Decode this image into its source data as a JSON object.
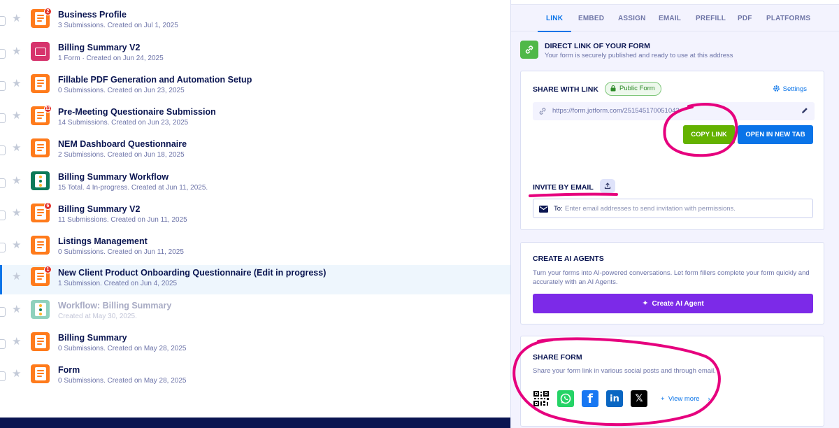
{
  "forms": [
    {
      "title": "Business Profile",
      "meta": "3 Submissions. Created on Jul 1, 2025",
      "badge": "2",
      "icon": "form-icon",
      "color": "#ff7b1c"
    },
    {
      "title": "Billing Summary V2",
      "meta": "1 Form · Created on Jun 24, 2025",
      "badge": "",
      "icon": "sign-document-icon",
      "color": "#d6336c"
    },
    {
      "title": "Fillable PDF Generation and Automation Setup",
      "meta": "0 Submissions. Created on Jun 23, 2025",
      "badge": "",
      "icon": "form-icon",
      "color": "#ff7b1c"
    },
    {
      "title": "Pre-Meeting Questionaire Submission",
      "meta": "14 Submissions. Created on Jun 23, 2025",
      "badge": "11",
      "icon": "form-icon",
      "color": "#ff7b1c"
    },
    {
      "title": "NEM Dashboard Questionnaire",
      "meta": "2 Submissions. Created on Jun 18, 2025",
      "badge": "",
      "icon": "form-icon",
      "color": "#ff7b1c"
    },
    {
      "title": "Billing Summary Workflow",
      "meta": "15 Total. 4 In-progress. Created at Jun 11, 2025.",
      "badge": "",
      "icon": "workflow-icon",
      "color": "#0b7a58"
    },
    {
      "title": "Billing Summary V2",
      "meta": "11 Submissions. Created on Jun 11, 2025",
      "badge": "6",
      "icon": "form-icon",
      "color": "#ff7b1c"
    },
    {
      "title": "Listings Management",
      "meta": "0 Submissions. Created on Jun 11, 2025",
      "badge": "",
      "icon": "form-icon",
      "color": "#ff7b1c"
    },
    {
      "title": "New Client Product Onboarding Questionnaire (Edit in progress)",
      "meta": "1 Submission. Created on Jun 4, 2025",
      "badge": "1",
      "icon": "form-icon",
      "color": "#ff7b1c"
    },
    {
      "title": "Workflow: Billing Summary",
      "meta": "Created at May 30, 2025.",
      "badge": "",
      "icon": "workflow-icon",
      "color": "#8fd1bd"
    },
    {
      "title": "Billing Summary",
      "meta": "0 Submissions. Created on May 28, 2025",
      "badge": "",
      "icon": "form-icon",
      "color": "#ff7b1c"
    },
    {
      "title": "Form",
      "meta": "0 Submissions. Created on May 28, 2025",
      "badge": "",
      "icon": "form-icon",
      "color": "#ff7b1c"
    }
  ],
  "tabs": [
    "LINK",
    "EMBED",
    "ASSIGN",
    "EMAIL",
    "PREFILL",
    "PDF",
    "PLATFORMS"
  ],
  "direct": {
    "title": "DIRECT LINK OF YOUR FORM",
    "subtitle": "Your form is securely published and ready to use at this address"
  },
  "share": {
    "title": "SHARE WITH LINK",
    "status": "Public Form",
    "settings": "Settings",
    "url": "https://form.jotform.com/251545170051043",
    "copy_label": "COPY LINK",
    "open_label": "OPEN IN NEW TAB"
  },
  "invite": {
    "title": "INVITE BY EMAIL",
    "to_label": "To:",
    "placeholder": "Enter email addresses to send invitation with permissions."
  },
  "ai": {
    "title": "CREATE AI AGENTS",
    "description": "Turn your forms into AI-powered conversations. Let form fillers complete your form quickly and accurately with an AI Agents.",
    "button": "Create AI Agent"
  },
  "share_form": {
    "title": "SHARE FORM",
    "description": "Share your form link in various social posts and through email.",
    "socials": [
      "qr-code-icon",
      "whatsapp-icon",
      "facebook-icon",
      "linkedin-icon",
      "x-icon"
    ],
    "view_more": "View more"
  },
  "colors": {
    "accent": "#0a74e8",
    "copy_green": "#64b200",
    "ai_purple": "#7c2ae8",
    "annotation_pink": "#e6007e"
  }
}
